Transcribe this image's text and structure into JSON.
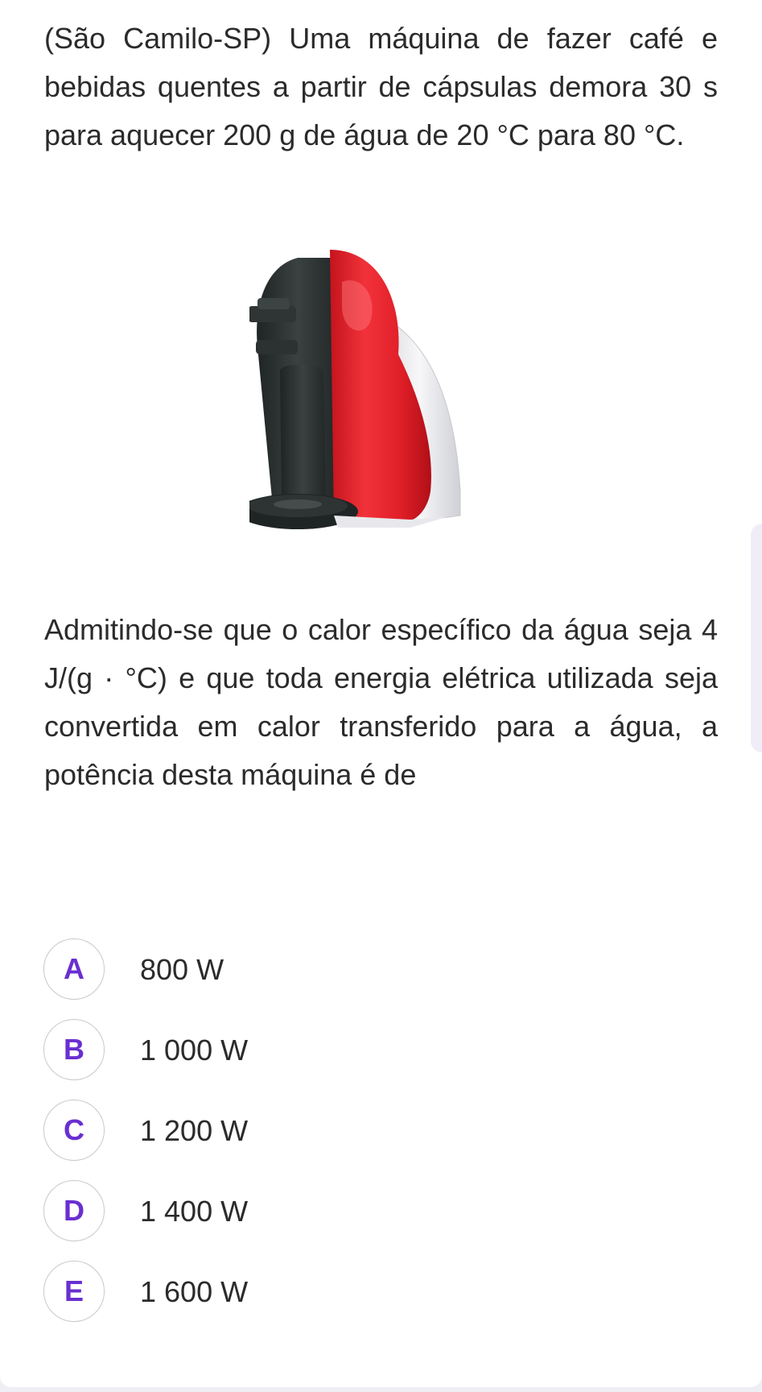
{
  "question": {
    "intro": "(São Camilo-SP) Uma máquina de fazer café e bebidas quentes a partir de cápsulas demora 30 s para aquecer 200 g de água de 20 °C para 80 °C.",
    "body": "Admitindo-se que o calor específico da água seja 4 J/(g · °C) e que toda energia elétrica utilizada seja convertida em calor transferido para a água, a potência desta máquina é de"
  },
  "image": {
    "subject": "coffee-capsule-machine",
    "colors": {
      "body_red": "#e8232b",
      "dark_gray": "#2d3333",
      "white_side": "#f1f1f3"
    }
  },
  "options": [
    {
      "letter": "A",
      "text": "800 W"
    },
    {
      "letter": "B",
      "text": "1 000 W"
    },
    {
      "letter": "C",
      "text": "1 200 W"
    },
    {
      "letter": "D",
      "text": "1 400 W"
    },
    {
      "letter": "E",
      "text": "1 600 W"
    }
  ],
  "theme": {
    "accent": "#6a2fd0",
    "text": "#2b2b2b",
    "badge_border": "#c9c9c9"
  }
}
